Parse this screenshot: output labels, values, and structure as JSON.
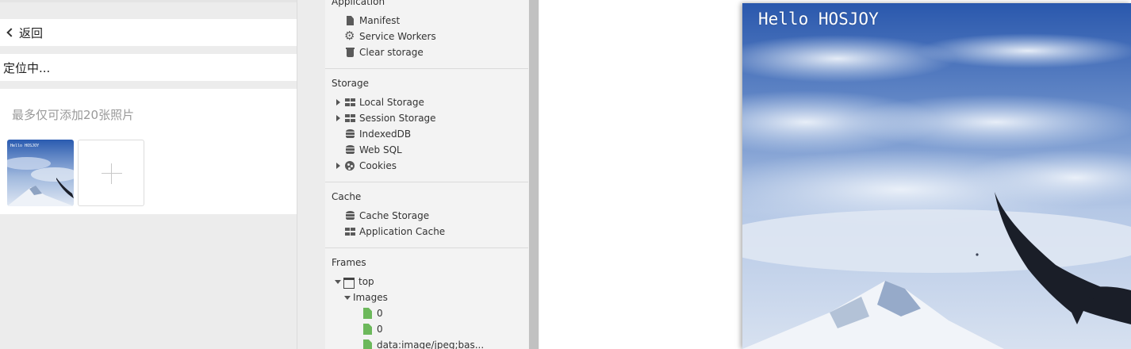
{
  "mobile": {
    "back_label": "返回",
    "location_text": "定位中...",
    "photo_hint": "最多仅可添加20张照片",
    "thumbnail_caption": "Hello HOSJOY"
  },
  "devtools": {
    "application": {
      "title": "Application",
      "items": [
        {
          "label": "Manifest",
          "icon": "file-icon"
        },
        {
          "label": "Service Workers",
          "icon": "gear-icon"
        },
        {
          "label": "Clear storage",
          "icon": "trash-icon"
        }
      ]
    },
    "storage": {
      "title": "Storage",
      "items": [
        {
          "label": "Local Storage",
          "icon": "grid-icon",
          "expandable": true
        },
        {
          "label": "Session Storage",
          "icon": "grid-icon",
          "expandable": true
        },
        {
          "label": "IndexedDB",
          "icon": "database-icon"
        },
        {
          "label": "Web SQL",
          "icon": "database-icon"
        },
        {
          "label": "Cookies",
          "icon": "cookie-icon",
          "expandable": true
        }
      ]
    },
    "cache": {
      "title": "Cache",
      "items": [
        {
          "label": "Cache Storage",
          "icon": "database-icon"
        },
        {
          "label": "Application Cache",
          "icon": "grid-icon"
        }
      ]
    },
    "frames": {
      "title": "Frames",
      "top_label": "top",
      "images_label": "Images",
      "files": [
        "0",
        "0",
        "data:image/jpeg;bas..."
      ]
    }
  },
  "preview": {
    "caption": "Hello HOSJOY"
  },
  "colors": {
    "devtools_bg": "#f3f3f3",
    "file_icon_green": "#6cb85b",
    "sky_blue": "#2f5fb0"
  }
}
